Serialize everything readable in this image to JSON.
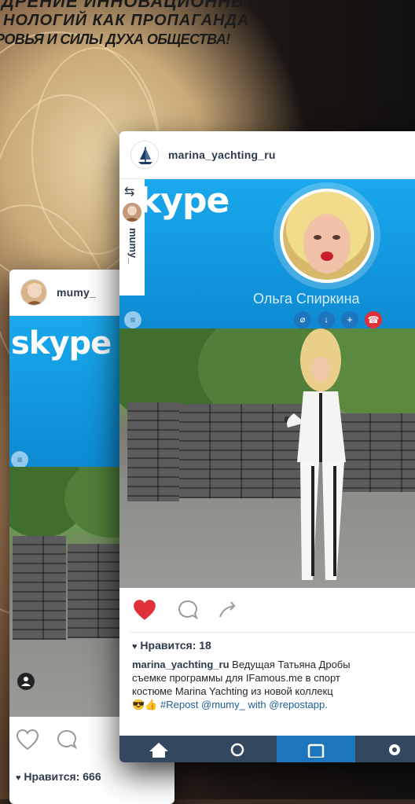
{
  "headline": {
    "line1": "ДРЕНИЕ ИННОВАЦИОННЫХ",
    "line2": "НОЛОГИЙ КАК ПРОПАГАНДА",
    "line3": "РОВЬЯ И СИЛЫ ДУХА ОБЩЕСТВА!"
  },
  "front_post": {
    "username": "marina_yachting_ru",
    "skype_logo": "kype",
    "repost_vertical": "mumy_",
    "caller_name": "Ольга Спиркина",
    "likes": "Нравится: 18",
    "caption_user": "marina_yachting_ru",
    "caption_line1": "Ведущая Татьяна Дробы",
    "caption_line2": "съемке программы для IFamous.me в спорт",
    "caption_line3": "костюме Marina Yachting из новой коллекц",
    "caption_line4": "#Repost @mumy_ with @repostapp.",
    "emoji": "😎👍",
    "colors": {
      "like": "#e0303a",
      "skype": "#1aa8ec",
      "navbar": "#33485e",
      "navbar_active": "#1d75bd"
    }
  },
  "back_post": {
    "username": "mumy_",
    "skype_logo": "skype",
    "likes": "Нравится: 666"
  },
  "icons": [
    "heart-icon",
    "comment-icon",
    "share-icon",
    "home-icon",
    "search-icon",
    "camera-icon",
    "profile-icon",
    "user-tag-icon",
    "menu-icon",
    "repost-icon"
  ]
}
